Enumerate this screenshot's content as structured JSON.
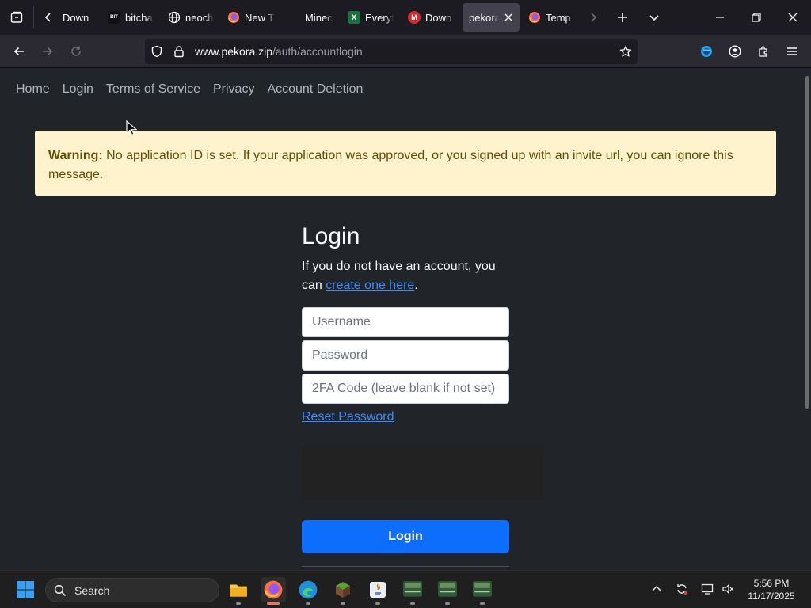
{
  "browser": {
    "tabs": [
      {
        "label": "Down",
        "icon": "download-favicon-icon"
      },
      {
        "label": "bitcha",
        "icon": "bitchat-favicon-icon",
        "icon_text": "BIT"
      },
      {
        "label": "neoch",
        "icon": "globe-icon"
      },
      {
        "label": "New T",
        "icon": "firefox-icon"
      },
      {
        "label": "Minec",
        "icon": "blank-favicon-icon"
      },
      {
        "label": "Everyt",
        "icon": "excel-favicon-icon"
      },
      {
        "label": "Down",
        "icon": "mega-favicon-icon",
        "icon_text": "M"
      },
      {
        "label": "pekora",
        "icon": "none",
        "active": true
      },
      {
        "label": "Temp",
        "icon": "firefox-icon"
      }
    ],
    "url_host": "www.pekora.zip",
    "url_path": "/auth/accountlogin"
  },
  "page": {
    "nav": [
      "Home",
      "Login",
      "Terms of Service",
      "Privacy",
      "Account Deletion"
    ],
    "warning_label": "Warning:",
    "warning_text": " No application ID is set. If your application was approved, or you signed up with an invite url, you can ignore this message.",
    "title": "Login",
    "desc_before": "If you do not have an account, you can ",
    "desc_link": "create one here",
    "desc_after": ".",
    "username_placeholder": "Username",
    "password_placeholder": "Password",
    "twofa_placeholder": "2FA Code (leave blank if not set)",
    "reset_link": "Reset Password",
    "login_button": "Login"
  },
  "taskbar": {
    "search_label": "Search",
    "time": "5:56 PM",
    "date": "11/17/2025"
  },
  "colors": {
    "page_bg": "#212529",
    "warning_bg": "#fff3cd",
    "warning_text": "#664d03",
    "primary": "#0d6efd",
    "link": "#3d8bfd"
  }
}
